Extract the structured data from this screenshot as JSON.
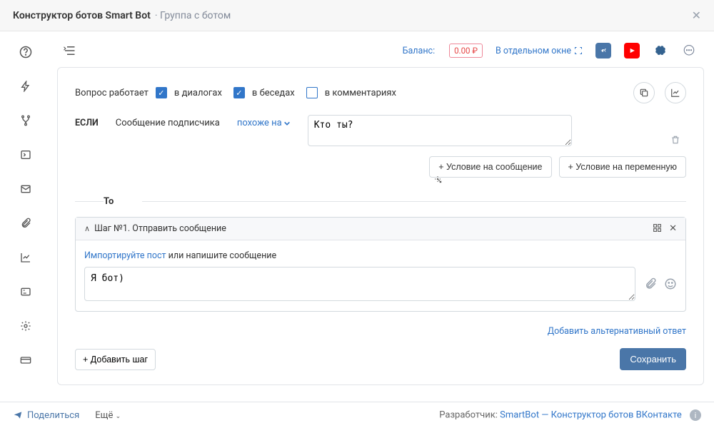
{
  "header": {
    "title": "Конструктор ботов Smart Bot",
    "sub": "Группа с ботом"
  },
  "topbar": {
    "balance_label": "Баланс:",
    "balance_value": "0.00 ₽",
    "new_window": "В отдельном окне"
  },
  "question": {
    "works_label": "Вопрос работает",
    "dialogs": "в диалогах",
    "chats": "в беседах",
    "comments": "в комментариях",
    "dialogs_on": true,
    "chats_on": true,
    "comments_on": false
  },
  "if_block": {
    "if": "ЕСЛИ",
    "sub_msg": "Сообщение подписчика",
    "like": "похоже на",
    "text": "Кто ты?",
    "cond_msg": "+ Условие на сообщение",
    "cond_var": "+ Условие на переменную"
  },
  "to_label": "То",
  "step": {
    "title": "Шаг №1. Отправить сообщение",
    "import_link": "Импортируйте пост",
    "import_rest": " или напишите сообщение",
    "response": "Я бот)",
    "alt_link": "Добавить альтернативный ответ"
  },
  "buttons": {
    "add_step": "+ Добавить шаг",
    "save": "Сохранить"
  },
  "footer": {
    "share": "Поделиться",
    "more": "Ещё",
    "developer_label": "Разработчик:",
    "developer_link": "SmartBot — Конструктор ботов ВКонтакте"
  }
}
